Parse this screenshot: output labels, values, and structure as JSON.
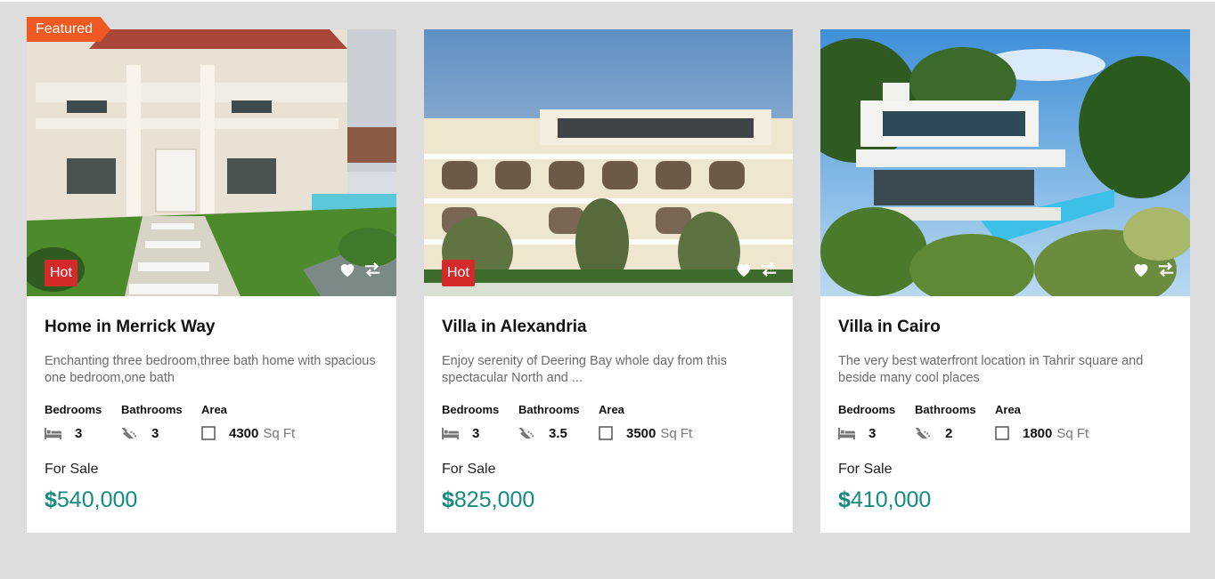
{
  "featured_label": "Featured",
  "colors": {
    "accent": "#138c80",
    "hot": "#d42a2a",
    "featured": "#f05a22",
    "background": "#dddddd"
  },
  "listings": [
    {
      "badge": "Hot",
      "title": "Home in Merrick Way",
      "description": "Enchanting three bedroom,three bath home with spacious one bedroom,one bath",
      "bedrooms_label": "Bedrooms",
      "bathrooms_label": "Bathrooms",
      "area_label": "Area",
      "bedrooms": "3",
      "bathrooms": "3",
      "area": "4300",
      "area_unit": "Sq Ft",
      "status": "For Sale",
      "currency": "$",
      "price": "540,000",
      "icons": [
        "heart-icon",
        "compare-icon",
        "bed-icon",
        "bath-icon",
        "area-icon"
      ]
    },
    {
      "badge": "Hot",
      "title": "Villa in Alexandria",
      "description": "Enjoy serenity of Deering Bay whole day from this spectacular North and ...",
      "bedrooms_label": "Bedrooms",
      "bathrooms_label": "Bathrooms",
      "area_label": "Area",
      "bedrooms": "3",
      "bathrooms": "3.5",
      "area": "3500",
      "area_unit": "Sq Ft",
      "status": "For Sale",
      "currency": "$",
      "price": "825,000",
      "icons": [
        "heart-icon",
        "compare-icon",
        "bed-icon",
        "bath-icon",
        "area-icon"
      ]
    },
    {
      "title": "Villa in Cairo",
      "description": "The very best waterfront location in Tahrir square and beside many cool places",
      "bedrooms_label": "Bedrooms",
      "bathrooms_label": "Bathrooms",
      "area_label": "Area",
      "bedrooms": "3",
      "bathrooms": "2",
      "area": "1800",
      "area_unit": "Sq Ft",
      "status": "For Sale",
      "currency": "$",
      "price": "410,000",
      "icons": [
        "heart-icon",
        "compare-icon",
        "bed-icon",
        "bath-icon",
        "area-icon"
      ]
    }
  ]
}
